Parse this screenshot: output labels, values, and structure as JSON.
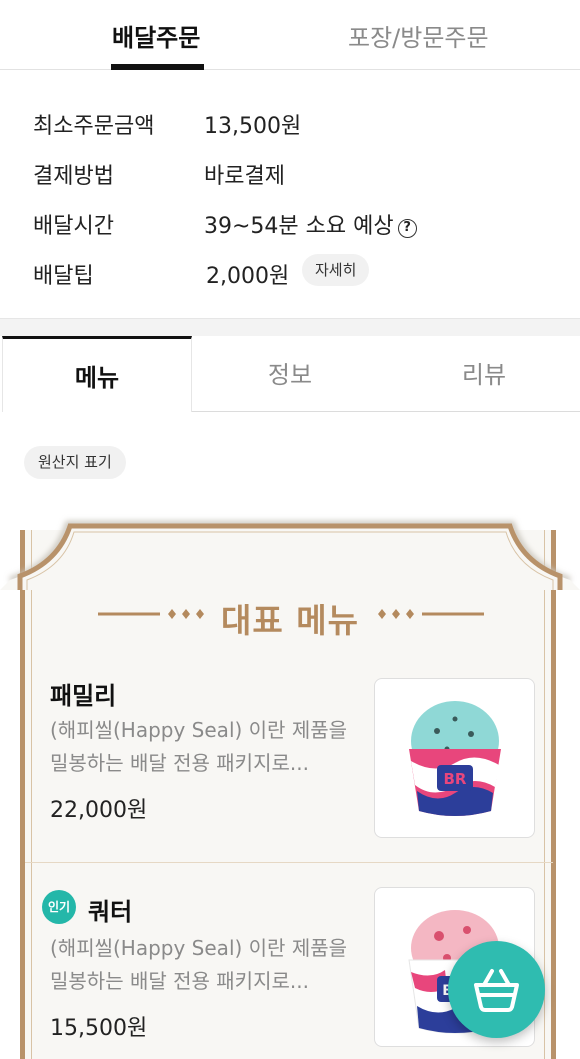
{
  "order_tabs": {
    "delivery": "배달주문",
    "pickup": "포장/방문주문"
  },
  "info": {
    "min_order_label": "최소주문금액",
    "min_order_value": "13,500원",
    "payment_label": "결제방법",
    "payment_value": "바로결제",
    "delivery_time_label": "배달시간",
    "delivery_time_value": "39~54분 소요 예상",
    "tip_label": "배달팁",
    "tip_value": "2,000원",
    "tip_detail": "자세히"
  },
  "main_tabs": {
    "menu": "메뉴",
    "info": "정보",
    "review": "리뷰"
  },
  "origin_label": "원산지 표기",
  "featured": {
    "title": "대표 메뉴",
    "items": [
      {
        "name": "패밀리",
        "desc_line1": "(해피씰(Happy Seal) 이란 제품을",
        "desc_line2": "밀봉하는 배달 전용 패키지로...",
        "price": "22,000원",
        "badge": ""
      },
      {
        "name": "쿼터",
        "desc_line1": "(해피씰(Happy Seal) 이란 제품을",
        "desc_line2": "밀봉하는 배달 전용 패키지로...",
        "price": "15,500원",
        "badge": "인기"
      }
    ]
  },
  "colors": {
    "accent_teal": "#2fbcb0",
    "frame_gold": "#b8926a",
    "title_gold": "#b48a5e"
  }
}
